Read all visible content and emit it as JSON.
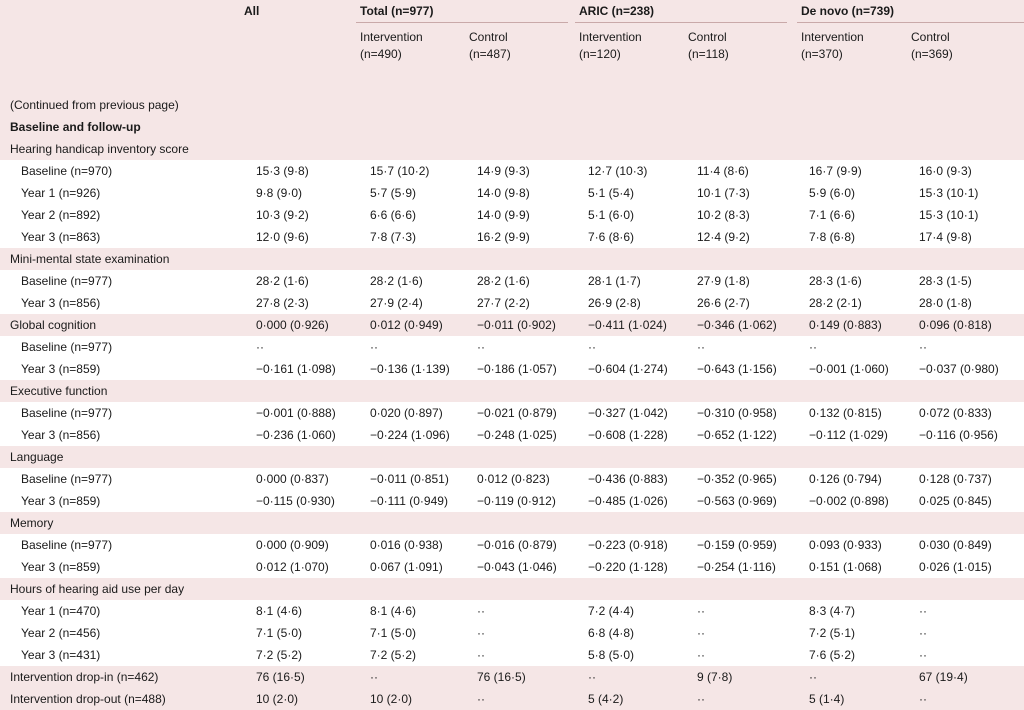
{
  "header": {
    "all": "All",
    "groups": [
      {
        "title": "Total (n=977)",
        "sub": [
          [
            "Intervention",
            "(n=490)"
          ],
          [
            "Control",
            "(n=487)"
          ]
        ]
      },
      {
        "title": "ARIC (n=238)",
        "sub": [
          [
            "Intervention",
            "(n=120)"
          ],
          [
            "Control",
            "(n=118)"
          ]
        ]
      },
      {
        "title": "De novo (n=739)",
        "sub": [
          [
            "Intervention",
            "(n=370)"
          ],
          [
            "Control",
            "(n=369)"
          ]
        ]
      }
    ]
  },
  "continued": "(Continued from previous page)",
  "section_title": "Baseline and follow-up",
  "rows": [
    {
      "type": "section",
      "label": "Hearing handicap inventory score",
      "vals": []
    },
    {
      "type": "sub",
      "label": "Baseline (n=970)",
      "vals": [
        "15·3 (9·8)",
        "15·7 (10·2)",
        "14·9 (9·3)",
        "12·7 (10·3)",
        "11·4 (8·6)",
        "16·7 (9·9)",
        "16·0 (9·3)"
      ]
    },
    {
      "type": "sub",
      "label": "Year 1 (n=926)",
      "vals": [
        "9·8 (9·0)",
        "5·7 (5·9)",
        "14·0 (9·8)",
        "5·1 (5·4)",
        "10·1 (7·3)",
        "5·9 (6·0)",
        "15·3 (10·1)"
      ]
    },
    {
      "type": "sub",
      "label": "Year 2 (n=892)",
      "vals": [
        "10·3 (9·2)",
        "6·6 (6·6)",
        "14·0 (9·9)",
        "5·1 (6·0)",
        "10·2 (8·3)",
        "7·1 (6·6)",
        "15·3 (10·1)"
      ]
    },
    {
      "type": "sub",
      "label": "Year 3 (n=863)",
      "vals": [
        "12·0 (9·6)",
        "7·8 (7·3)",
        "16·2 (9·9)",
        "7·6 (8·6)",
        "12·4 (9·2)",
        "7·8 (6·8)",
        "17·4 (9·8)"
      ]
    },
    {
      "type": "section",
      "label": "Mini-mental state examination",
      "vals": []
    },
    {
      "type": "sub",
      "label": "Baseline (n=977)",
      "vals": [
        "28·2 (1·6)",
        "28·2 (1·6)",
        "28·2 (1·6)",
        "28·1 (1·7)",
        "27·9 (1·8)",
        "28·3 (1·6)",
        "28·3 (1·5)"
      ]
    },
    {
      "type": "sub",
      "label": "Year 3 (n=856)",
      "vals": [
        "27·8 (2·3)",
        "27·9 (2·4)",
        "27·7 (2·2)",
        "26·9 (2·8)",
        "26·6 (2·7)",
        "28·2 (2·1)",
        "28·0 (1·8)"
      ]
    },
    {
      "type": "section",
      "label": "Global cognition",
      "vals": [
        "0·000 (0·926)",
        "0·012 (0·949)",
        "−0·011 (0·902)",
        "−0·411 (1·024)",
        "−0·346 (1·062)",
        "0·149 (0·883)",
        "0·096 (0·818)"
      ]
    },
    {
      "type": "sub",
      "label": "Baseline (n=977)",
      "vals": [
        "··",
        "··",
        "··",
        "··",
        "··",
        "··",
        "··"
      ]
    },
    {
      "type": "sub",
      "label": "Year 3 (n=859)",
      "vals": [
        "−0·161 (1·098)",
        "−0·136 (1·139)",
        "−0·186 (1·057)",
        "−0·604 (1·274)",
        "−0·643 (1·156)",
        "−0·001 (1·060)",
        "−0·037 (0·980)"
      ]
    },
    {
      "type": "section",
      "label": "Executive function",
      "vals": []
    },
    {
      "type": "sub",
      "label": "Baseline (n=977)",
      "vals": [
        "−0·001 (0·888)",
        "0·020 (0·897)",
        "−0·021 (0·879)",
        "−0·327 (1·042)",
        "−0·310 (0·958)",
        "0·132 (0·815)",
        "0·072 (0·833)"
      ]
    },
    {
      "type": "sub",
      "label": "Year 3 (n=856)",
      "vals": [
        "−0·236 (1·060)",
        "−0·224 (1·096)",
        "−0·248 (1·025)",
        "−0·608 (1·228)",
        "−0·652 (1·122)",
        "−0·112 (1·029)",
        "−0·116 (0·956)"
      ]
    },
    {
      "type": "section",
      "label": "Language",
      "vals": []
    },
    {
      "type": "sub",
      "label": "Baseline (n=977)",
      "vals": [
        "0·000 (0·837)",
        "−0·011 (0·851)",
        "0·012 (0·823)",
        "−0·436 (0·883)",
        "−0·352 (0·965)",
        "0·126 (0·794)",
        "0·128 (0·737)"
      ]
    },
    {
      "type": "sub",
      "label": "Year 3 (n=859)",
      "vals": [
        "−0·115 (0·930)",
        "−0·111 (0·949)",
        "−0·119 (0·912)",
        "−0·485 (1·026)",
        "−0·563 (0·969)",
        "−0·002 (0·898)",
        "0·025 (0·845)"
      ]
    },
    {
      "type": "section",
      "label": "Memory",
      "vals": []
    },
    {
      "type": "sub",
      "label": "Baseline (n=977)",
      "vals": [
        "0·000 (0·909)",
        "0·016 (0·938)",
        "−0·016 (0·879)",
        "−0·223 (0·918)",
        "−0·159 (0·959)",
        "0·093 (0·933)",
        "0·030 (0·849)"
      ]
    },
    {
      "type": "sub",
      "label": "Year 3 (n=859)",
      "vals": [
        "0·012 (1·070)",
        "0·067 (1·091)",
        "−0·043 (1·046)",
        "−0·220 (1·128)",
        "−0·254 (1·116)",
        "0·151 (1·068)",
        "0·026 (1·015)"
      ]
    },
    {
      "type": "section",
      "label": "Hours of hearing aid use per day",
      "vals": []
    },
    {
      "type": "sub",
      "label": "Year 1 (n=470)",
      "vals": [
        "8·1 (4·6)",
        "8·1 (4·6)",
        "··",
        "7·2 (4·4)",
        "··",
        "8·3 (4·7)",
        "··"
      ]
    },
    {
      "type": "sub",
      "label": "Year 2 (n=456)",
      "vals": [
        "7·1 (5·0)",
        "7·1 (5·0)",
        "··",
        "6·8 (4·8)",
        "··",
        "7·2 (5·1)",
        "··"
      ]
    },
    {
      "type": "sub",
      "label": "Year 3 (n=431)",
      "vals": [
        "7·2 (5·2)",
        "7·2 (5·2)",
        "··",
        "5·8 (5·0)",
        "··",
        "7·6 (5·2)",
        "··"
      ]
    },
    {
      "type": "section",
      "label": "Intervention drop-in (n=462)",
      "vals": [
        "76 (16·5)",
        "··",
        "76 (16·5)",
        "··",
        "9 (7·8)",
        "··",
        "67 (19·4)"
      ]
    },
    {
      "type": "section",
      "label": "Intervention drop-out (n=488)",
      "vals": [
        "10 (2·0)",
        "10 (2·0)",
        "··",
        "5 (4·2)",
        "··",
        "5 (1·4)",
        "··"
      ]
    }
  ]
}
